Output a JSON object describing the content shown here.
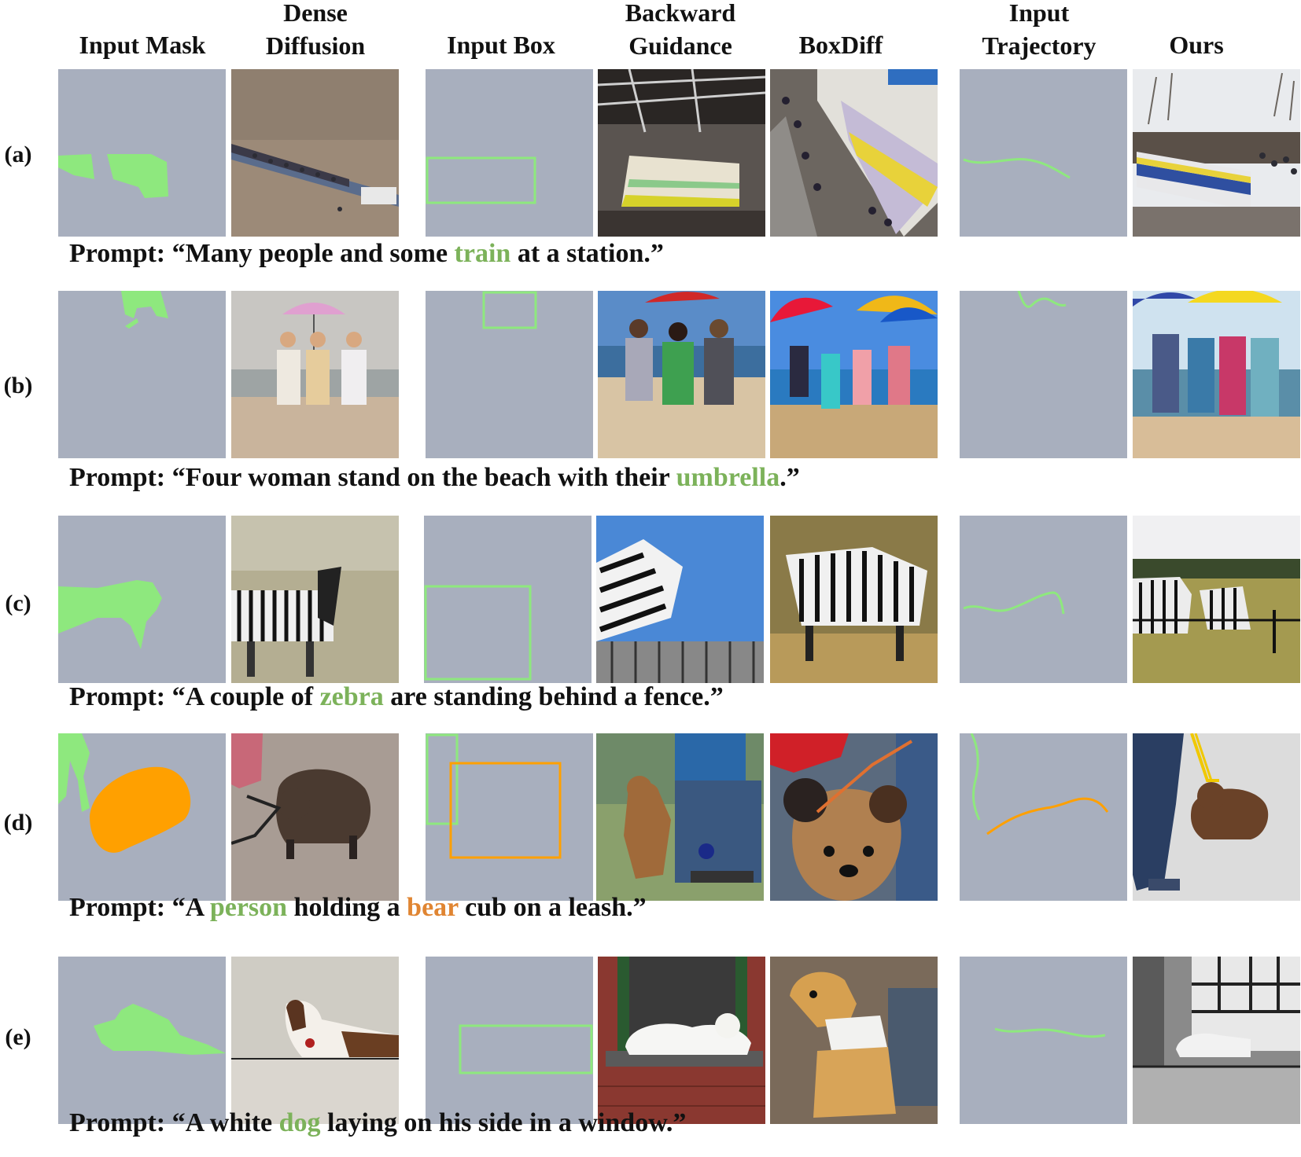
{
  "colors": {
    "placeholder_bg": "#a8afbe",
    "green_mask": "#8ee87e",
    "orange_mask": "#ffa000",
    "green_text": "#7cb25a",
    "orange_text": "#e08532"
  },
  "headers": {
    "input_mask": "Input Mask",
    "dense_line1": "Dense",
    "dense_line2": "Diffusion",
    "input_box": "Input Box",
    "backward_line1": "Backward",
    "backward_line2": "Guidance",
    "boxdiff": "BoxDiff",
    "traj_line1": "Input",
    "traj_line2": "Trajectory",
    "ours": "Ours"
  },
  "rows": [
    {
      "label": "(a)",
      "prompt_prefix": "Prompt: “Many people and some ",
      "prompt_word1": "train",
      "prompt_mid": " at a station.”",
      "prompt_word2": "",
      "prompt_suffix": ""
    },
    {
      "label": "(b)",
      "prompt_prefix": "Prompt: “Four woman stand on the beach with their ",
      "prompt_word1": "umbrella",
      "prompt_mid": ".”",
      "prompt_word2": "",
      "prompt_suffix": ""
    },
    {
      "label": "(c)",
      "prompt_prefix": "Prompt: “A couple of ",
      "prompt_word1": "zebra",
      "prompt_mid": " are standing behind a fence.”",
      "prompt_word2": "",
      "prompt_suffix": ""
    },
    {
      "label": "(d)",
      "prompt_prefix": "Prompt: “A ",
      "prompt_word1": "person",
      "prompt_mid": " holding a ",
      "prompt_word2": "bear",
      "prompt_suffix": " cub on a leash.”"
    },
    {
      "label": "(e)",
      "prompt_prefix": "Prompt: “A white ",
      "prompt_word1": "dog",
      "prompt_mid": " laying on his side in a window.”",
      "prompt_word2": "",
      "prompt_suffix": ""
    }
  ]
}
